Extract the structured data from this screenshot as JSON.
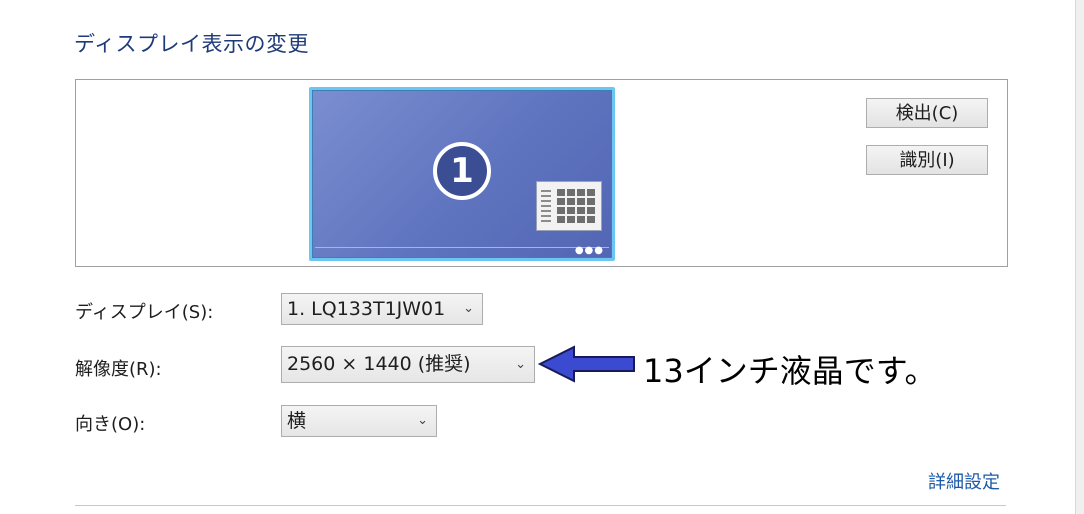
{
  "title": "ディスプレイ表示の変更",
  "preview": {
    "monitor_number": "1"
  },
  "buttons": {
    "detect": "検出(C)",
    "identify": "識別(I)"
  },
  "display": {
    "label": "ディスプレイ(S):",
    "value": "1. LQ133T1JW01"
  },
  "resolution": {
    "label": "解像度(R):",
    "value": "2560 × 1440 (推奨)"
  },
  "orientation": {
    "label": "向き(O):",
    "value": "横"
  },
  "annotation": {
    "text": "13インチ液晶です。",
    "arrow_color": "#3a4bd1"
  },
  "advanced_link": "詳細設定",
  "icons": {
    "dropdown": "chevron-down-icon",
    "annotation_arrow": "arrow-left-icon"
  }
}
